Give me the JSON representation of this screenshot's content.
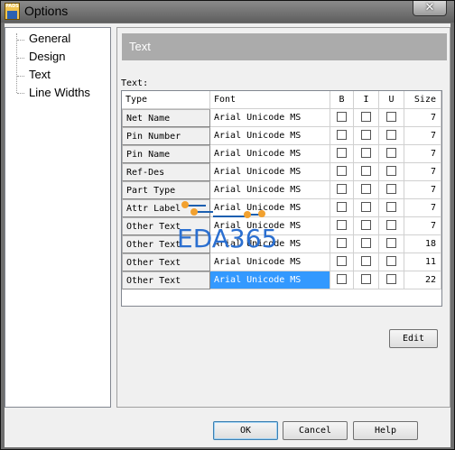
{
  "window": {
    "title": "Options",
    "close_glyph": "✕",
    "app_icon": "pads-logo-icon",
    "app_icon_text": "PADS"
  },
  "tree": {
    "items": [
      {
        "label": "General"
      },
      {
        "label": "Design"
      },
      {
        "label": "Text"
      },
      {
        "label": "Line Widths"
      }
    ],
    "selected": "Text"
  },
  "panel": {
    "header": "Text",
    "section_label": "Text:"
  },
  "grid": {
    "headers": {
      "type": "Type",
      "font": "Font",
      "b": "B",
      "i": "I",
      "u": "U",
      "size": "Size"
    },
    "rows": [
      {
        "type": "Net Name",
        "font": "Arial Unicode MS",
        "b": false,
        "i": false,
        "u": false,
        "size": "7"
      },
      {
        "type": "Pin Number",
        "font": "Arial Unicode MS",
        "b": false,
        "i": false,
        "u": false,
        "size": "7"
      },
      {
        "type": "Pin Name",
        "font": "Arial Unicode MS",
        "b": false,
        "i": false,
        "u": false,
        "size": "7"
      },
      {
        "type": "Ref-Des",
        "font": "Arial Unicode MS",
        "b": false,
        "i": false,
        "u": false,
        "size": "7"
      },
      {
        "type": "Part Type",
        "font": "Arial Unicode MS",
        "b": false,
        "i": false,
        "u": false,
        "size": "7"
      },
      {
        "type": "Attr Label",
        "font": "Arial Unicode MS",
        "b": false,
        "i": false,
        "u": false,
        "size": "7"
      },
      {
        "type": "Other Text",
        "font": "Arial Unicode MS",
        "b": false,
        "i": false,
        "u": false,
        "size": "7"
      },
      {
        "type": "Other Text",
        "font": "Arial Unicode MS",
        "b": false,
        "i": false,
        "u": false,
        "size": "18"
      },
      {
        "type": "Other Text",
        "font": "Arial Unicode MS",
        "b": false,
        "i": false,
        "u": false,
        "size": "11"
      },
      {
        "type": "Other Text",
        "font": "Arial Unicode MS",
        "b": false,
        "i": false,
        "u": false,
        "size": "22"
      }
    ],
    "selected_font_row": 9
  },
  "buttons": {
    "edit": "Edit",
    "ok": "OK",
    "cancel": "Cancel",
    "help": "Help"
  },
  "watermark": {
    "text": "EDA365",
    "color": "#2b6fd0"
  },
  "colors": {
    "selection": "#3399ff",
    "header_band": "#ababab",
    "window_frame": "#6f6f6f"
  }
}
